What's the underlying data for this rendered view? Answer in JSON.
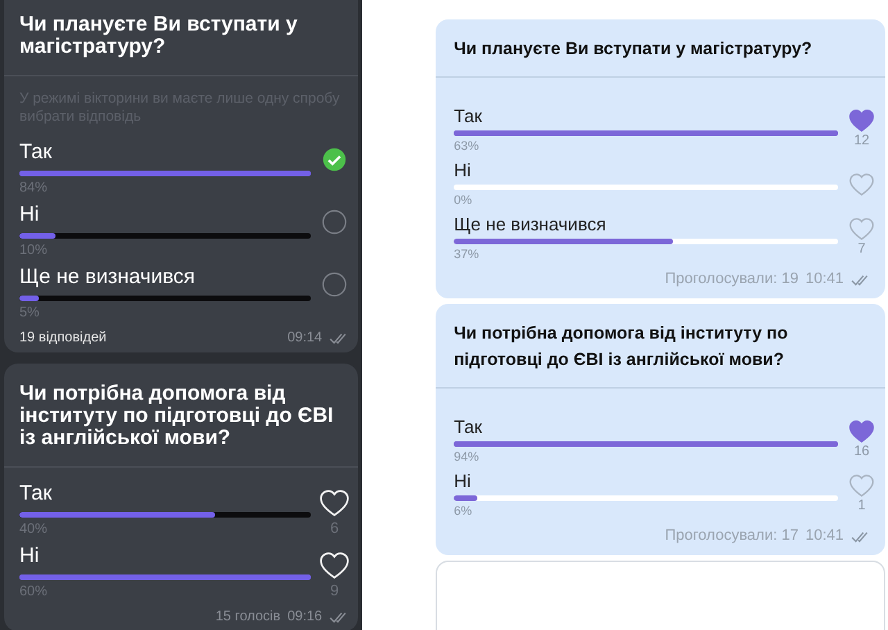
{
  "panels": [
    {
      "kind": "dark",
      "polls": [
        {
          "question": "Чи плануєте Ви вступати у магістратуру?",
          "note": "У режимі вікторини ви маєте лише одну спробу вибрати відповідь",
          "options": [
            {
              "label": "Так",
              "percent": "84%",
              "level": 1,
              "kind": "radio",
              "selected": true
            },
            {
              "label": "Ні",
              "percent": "10%",
              "level": 0.125,
              "kind": "radio",
              "selected": false
            },
            {
              "label": "Ще не визначився",
              "percent": "5%",
              "level": 0.065,
              "kind": "radio",
              "selected": false
            }
          ],
          "votes": "19 відповідей",
          "time": "09:14"
        },
        {
          "question": "Чи потрібна допомога від інституту по підготовці до ЄВІ із англійської мови?",
          "options": [
            {
              "label": "Так",
              "percent": "40%",
              "level": 0.67,
              "kind": "heart",
              "selected": false,
              "count": "6"
            },
            {
              "label": "Ні",
              "percent": "60%",
              "level": 1,
              "kind": "heart",
              "selected": false,
              "count": "9"
            }
          ],
          "votes": "15 голосів",
          "time": "09:16"
        }
      ]
    },
    {
      "kind": "light",
      "more_below": true,
      "polls": [
        {
          "question": "Чи плануєте Ви вступати у магістратуру?",
          "options": [
            {
              "label": "Так",
              "percent": "63%",
              "level": 1,
              "kind": "heart",
              "selected": true,
              "count": "12"
            },
            {
              "label": "Ні",
              "percent": "0%",
              "level": 0,
              "kind": "heart",
              "selected": false
            },
            {
              "label": "Ще не визначився",
              "percent": "37%",
              "level": 0.57,
              "kind": "heart",
              "selected": false,
              "count": "7"
            }
          ],
          "votes": "Проголосували: 19",
          "time": "10:41"
        },
        {
          "question": "Чи потрібна допомога від інституту по підготовці до ЄВІ із англійської мови?",
          "options": [
            {
              "label": "Так",
              "percent": "94%",
              "level": 1,
              "kind": "heart",
              "selected": true,
              "count": "16"
            },
            {
              "label": "Ні",
              "percent": "6%",
              "level": 0.06,
              "kind": "heart",
              "selected": false,
              "count": "1"
            }
          ],
          "votes": "Проголосували: 17",
          "time": "10:41"
        }
      ]
    }
  ]
}
